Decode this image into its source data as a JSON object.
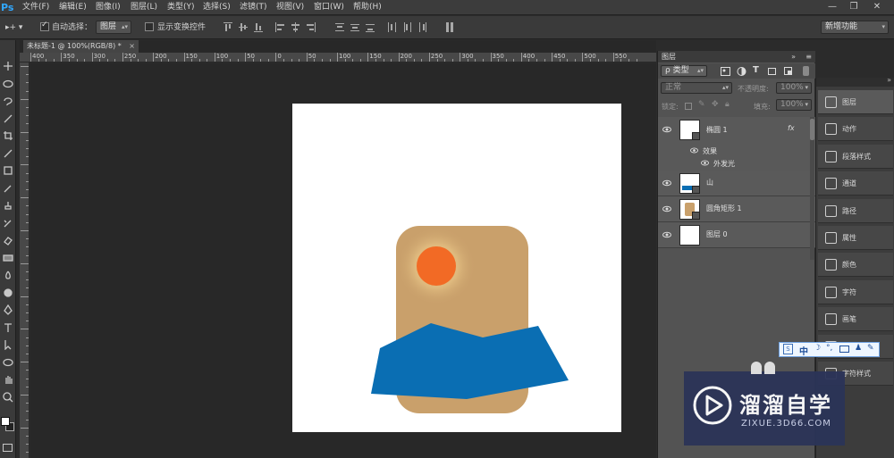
{
  "app": {
    "logo": "Ps"
  },
  "menu": {
    "items": [
      "文件(F)",
      "编辑(E)",
      "图像(I)",
      "图层(L)",
      "类型(Y)",
      "选择(S)",
      "滤镜(T)",
      "视图(V)",
      "窗口(W)",
      "帮助(H)"
    ]
  },
  "options": {
    "auto_select_label": "自动选择：",
    "auto_select_target": "图层",
    "show_transform_label": "显示变换控件",
    "workspace": "新增功能"
  },
  "document": {
    "tab_title": "未标题-1 @ 100%(RGB/8) *",
    "close": "×"
  },
  "rulers": {
    "top_labels": [
      "400",
      "350",
      "300",
      "250",
      "200",
      "150",
      "100",
      "50",
      "0",
      "50",
      "100",
      "150",
      "200",
      "250",
      "300",
      "350",
      "400",
      "450",
      "500",
      "550"
    ]
  },
  "layers_panel": {
    "title": "图层",
    "filter_kind": "ρ 类型",
    "blend_mode": "正常",
    "opacity_label": "不透明度:",
    "opacity_value": "100%",
    "lock_label": "锁定:",
    "fill_label": "填充:",
    "fill_value": "100%",
    "effects_label": "效果",
    "outer_glow_label": "外发光",
    "fx": "fx",
    "layers": [
      {
        "name": "椭圆 1",
        "thumb": "ellipse"
      },
      {
        "name": "山",
        "thumb": "mountain"
      },
      {
        "name": "圆角矩形 1",
        "thumb": "rounded-rect"
      },
      {
        "name": "图层 0",
        "thumb": "white"
      }
    ]
  },
  "dock": {
    "items": [
      {
        "label": "图层",
        "icon": "layers-icon"
      },
      {
        "label": "动作",
        "icon": "play-icon"
      },
      {
        "label": "段落样式",
        "icon": "paragraph-styles-icon"
      },
      {
        "label": "通道",
        "icon": "channels-icon"
      },
      {
        "label": "路径",
        "icon": "paths-icon"
      },
      {
        "label": "属性",
        "icon": "properties-icon"
      },
      {
        "label": "颜色",
        "icon": "palette-icon"
      },
      {
        "label": "字符",
        "icon": "character-icon"
      },
      {
        "label": "画笔",
        "icon": "brush-icon"
      },
      {
        "label": "画笔预设",
        "icon": "brush-presets-icon"
      },
      {
        "label": "字符样式",
        "icon": "character-styles-icon"
      }
    ]
  },
  "ime": {
    "lang": "中"
  },
  "watermark": {
    "title": "溜溜自学",
    "url": "ZIXUE.3D66.COM"
  },
  "colors": {
    "canvas_bg": "#ffffff",
    "rounded_rect": "#c9a06b",
    "sun": "#f26a25",
    "sun_glow": "#f5d77a",
    "mountain": "#0a6eb3",
    "arrow": "#e53b3b"
  }
}
